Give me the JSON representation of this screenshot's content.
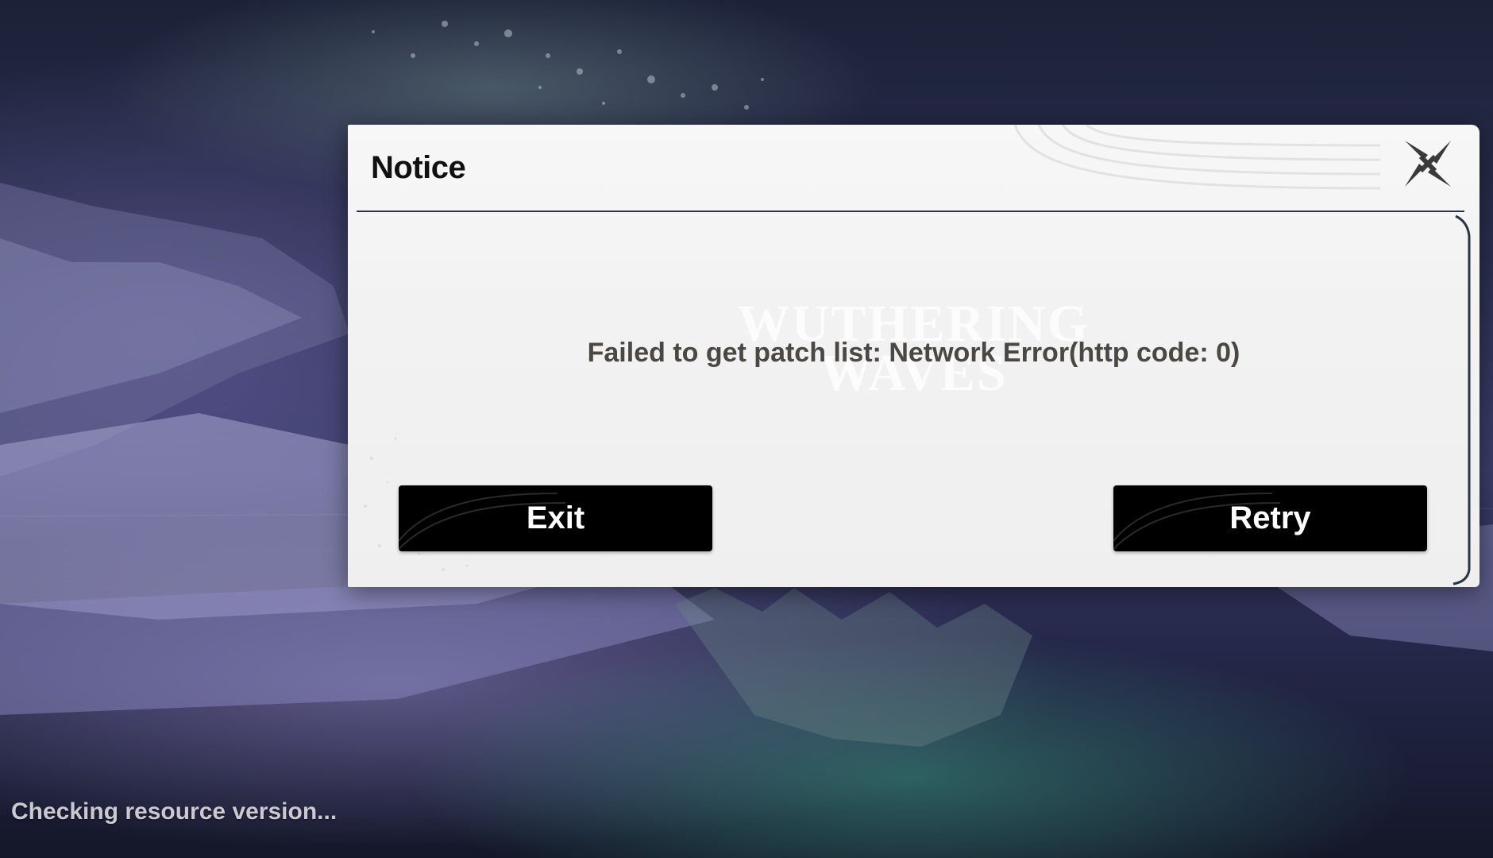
{
  "dialog": {
    "title": "Notice",
    "message": "Failed to get patch list: Network Error(http code: 0)",
    "watermark": [
      "WUTHERING",
      "WAVES"
    ],
    "close_icon": "close-x-icon",
    "exit_label": "Exit",
    "retry_label": "Retry"
  },
  "status": {
    "text": "Checking resource version..."
  },
  "colors": {
    "dialog_bg": "#f2f2f2",
    "button_bg": "#000000",
    "message_text": "#4b4742",
    "close_icon": "#3a3a3a"
  }
}
